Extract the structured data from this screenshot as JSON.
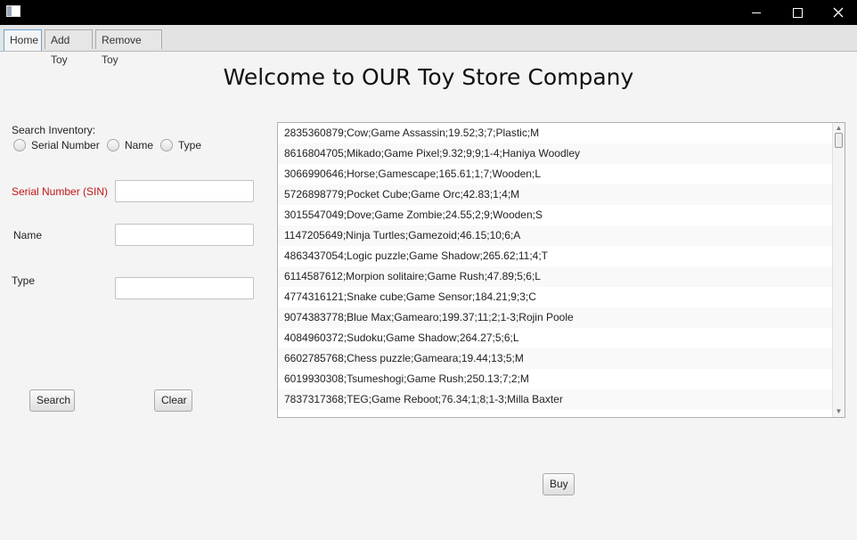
{
  "window": {
    "minimize_icon": "minimize-icon",
    "maximize_icon": "maximize-icon",
    "close_icon": "close-icon"
  },
  "tabs": [
    {
      "label": "Home",
      "active": true
    },
    {
      "label": "Add Toy",
      "active": false
    },
    {
      "label": "Remove Toy",
      "active": false
    }
  ],
  "heading": "Welcome to OUR Toy Store Company",
  "search": {
    "title": "Search Inventory:",
    "options": [
      "Serial Number",
      "Name",
      "Type"
    ],
    "fields": {
      "serial_label": "Serial Number (SIN)",
      "name_label": "Name",
      "type_label": "Type",
      "serial_value": "",
      "name_value": "",
      "type_value": ""
    },
    "search_button": "Search",
    "clear_button": "Clear"
  },
  "inventory": [
    "2835360879;Cow;Game Assassin;19.52;3;7;Plastic;M",
    "8616804705;Mikado;Game Pixel;9.32;9;9;1-4;Haniya Woodley",
    "3066990646;Horse;Gamescape;165.61;1;7;Wooden;L",
    "5726898779;Pocket Cube;Game Orc;42.83;1;4;M",
    "3015547049;Dove;Game Zombie;24.55;2;9;Wooden;S",
    "1147205649;Ninja Turtles;Gamezoid;46.15;10;6;A",
    "4863437054;Logic puzzle;Game Shadow;265.62;11;4;T",
    "6114587612;Morpion solitaire;Game Rush;47.89;5;6;L",
    "4774316121;Snake cube;Game Sensor;184.21;9;3;C",
    "9074383778;Blue Max;Gamearo;199.37;11;2;1-3;Rojin Poole",
    "4084960372;Sudoku;Game Shadow;264.27;5;6;L",
    "6602785768;Chess puzzle;Gameara;19.44;13;5;M",
    "6019930308;Tsumeshogi;Game Rush;250.13;7;2;M",
    "7837317368;TEG;Game Reboot;76.34;1;8;1-3;Milla Baxter"
  ],
  "buy_button": "Buy"
}
